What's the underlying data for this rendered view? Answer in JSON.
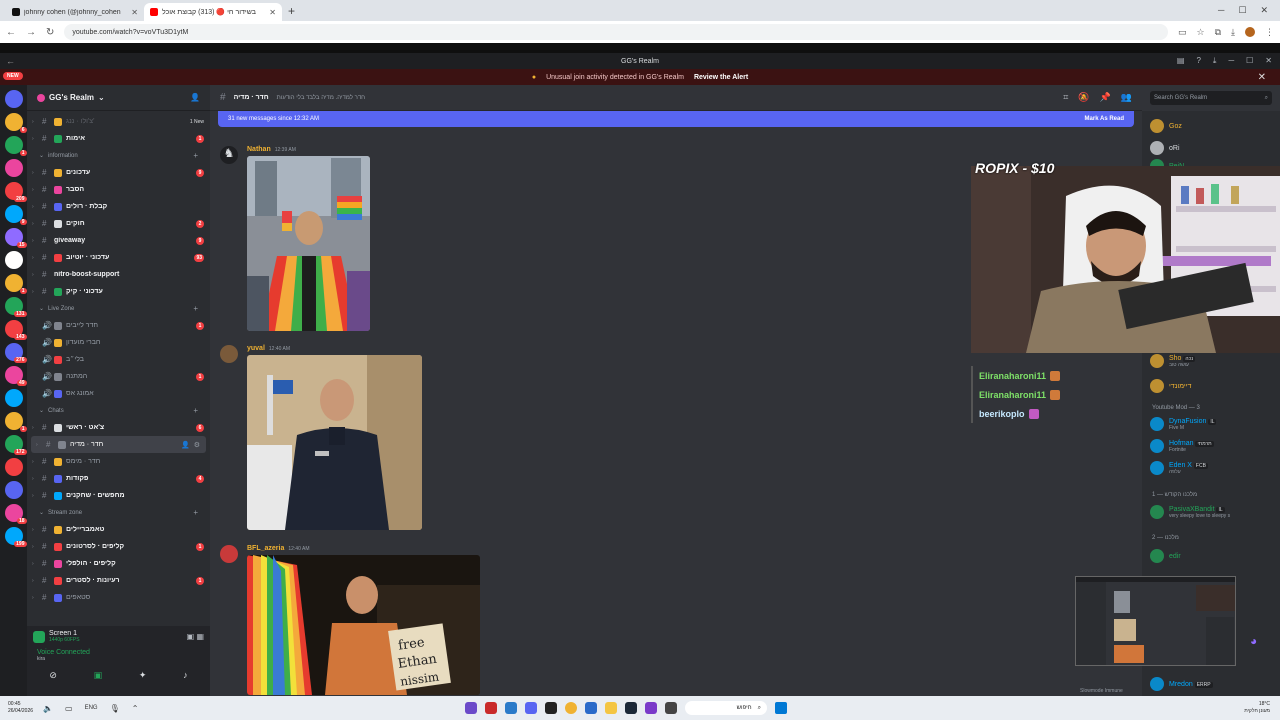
{
  "browser": {
    "tabs": [
      {
        "title": "johnny cohen (@johnny_cohen",
        "icon": "tiktok-icon",
        "color": "#111111"
      },
      {
        "title": "בשידור חי 🔴 (313) קבוצת אוכל",
        "icon": "youtube-icon",
        "color": "#ff0000"
      }
    ],
    "url": "youtube.com/watch?v=voVTu3D1ytM"
  },
  "discord": {
    "window_title": "GG's Realm",
    "alert_text": "Unusual join activity detected in GG's Realm",
    "alert_action": "Review the Alert",
    "new_label": "NEW"
  },
  "server_badges": [
    "",
    "6",
    "1",
    "",
    "209",
    "9",
    "15",
    "",
    "1",
    "131",
    "143",
    "276",
    "49",
    "",
    "1",
    "172",
    "",
    "",
    "18",
    "199"
  ],
  "sidebar": {
    "guild_name": "GG's Realm",
    "rows": [
      {
        "kind": "ch",
        "name": "צ'ולו · ננג'",
        "badge": "",
        "state": "muted",
        "emoji": "#f0b232",
        "extra": "1 New"
      },
      {
        "kind": "ch",
        "name": "אימות",
        "badge": "1",
        "state": "un",
        "emoji": "#23a559"
      },
      {
        "kind": "cat",
        "name": "information"
      },
      {
        "kind": "ch",
        "name": "עדכונים",
        "badge": "9",
        "state": "un",
        "emoji": "#f0b232"
      },
      {
        "kind": "ch",
        "name": "הסבר",
        "badge": "",
        "state": "un",
        "emoji": "#eb459e"
      },
      {
        "kind": "ch",
        "name": "קבלת · רולים",
        "badge": "",
        "state": "un",
        "emoji": "#5865f2"
      },
      {
        "kind": "ch",
        "name": "חוקים",
        "badge": "2",
        "state": "un",
        "emoji": "#dbdee1"
      },
      {
        "kind": "ch",
        "name": "giveaway",
        "badge": "9",
        "state": "un",
        "emoji": ""
      },
      {
        "kind": "ch",
        "name": "עדכוני · יוטיוב",
        "badge": "93",
        "state": "un",
        "emoji": "#f23f42"
      },
      {
        "kind": "ch",
        "name": "nitro-boost-support",
        "badge": "",
        "state": "un",
        "emoji": ""
      },
      {
        "kind": "ch",
        "name": "עדכוני · קיק",
        "badge": "",
        "state": "un",
        "emoji": "#23a559"
      },
      {
        "kind": "cat",
        "name": "Live Zone"
      },
      {
        "kind": "vc",
        "name": "חדר לייבים",
        "badge": "1",
        "state": "",
        "emoji": "#80848e"
      },
      {
        "kind": "vc",
        "name": "חברי מועדון",
        "badge": "",
        "state": "",
        "emoji": "#f0b232"
      },
      {
        "kind": "vc",
        "name": "בלי״ב",
        "badge": "",
        "state": "",
        "emoji": "#f23f42"
      },
      {
        "kind": "vc",
        "name": "המתנה",
        "badge": "1",
        "state": "",
        "emoji": "#80848e"
      },
      {
        "kind": "vc",
        "name": "אמונג אס",
        "badge": "",
        "state": "",
        "emoji": "#5865f2"
      },
      {
        "kind": "cat",
        "name": "Chats"
      },
      {
        "kind": "ch",
        "name": "צ'אט · ראשי",
        "badge": "6",
        "state": "un",
        "emoji": "#dbdee1"
      },
      {
        "kind": "ch",
        "name": "חדר · מדיה",
        "badge": "",
        "state": "sel",
        "emoji": "#80848e"
      },
      {
        "kind": "ch",
        "name": "חדר · מימס",
        "badge": "",
        "state": "",
        "emoji": "#f0b232"
      },
      {
        "kind": "ch",
        "name": "פקודות",
        "badge": "4",
        "state": "un",
        "emoji": "#5865f2"
      },
      {
        "kind": "ch",
        "name": "מחפשים · שחקנים",
        "badge": "",
        "state": "un",
        "emoji": "#00a8fc"
      },
      {
        "kind": "cat",
        "name": "Stream zone"
      },
      {
        "kind": "ch",
        "name": "טאמבריילים",
        "badge": "",
        "state": "un",
        "emoji": "#f0b232"
      },
      {
        "kind": "ch",
        "name": "קליפים · לסרטונים",
        "badge": "1",
        "state": "un",
        "emoji": "#f23f42"
      },
      {
        "kind": "ch",
        "name": "קליפים · הולפלי",
        "badge": "",
        "state": "un",
        "emoji": "#eb459e"
      },
      {
        "kind": "ch",
        "name": "רעיונות · לסטרים",
        "badge": "1",
        "state": "un",
        "emoji": "#f23f42"
      },
      {
        "kind": "ch",
        "name": "סטאפים",
        "badge": "",
        "state": "",
        "emoji": "#5865f2"
      }
    ],
    "screen_share": {
      "title": "Screen 1",
      "sub": "1440p 60FPS"
    },
    "voice": {
      "status": "Voice Connected",
      "channel": "kira"
    }
  },
  "channel": {
    "name": "חדר · מדיה",
    "topic": "חדר למדיה. מדיה בלבד בלי הודעות",
    "search_placeholder": "Search GG's Realm",
    "new_messages": "31 new messages since 12:32 AM",
    "mark_read": "Mark As Read"
  },
  "messages": [
    {
      "user": "Nathan",
      "time": "12:39 AM",
      "color": "#f0b232"
    },
    {
      "user": "yuval",
      "time": "12:40 AM",
      "color": "#f0b232"
    },
    {
      "user": "BFL_azeria",
      "time": "12:40 AM",
      "color": "#f0b232"
    }
  ],
  "image_texts": {
    "sign_line1": "free",
    "sign_line2": "Ethan",
    "sign_line3": "nissim"
  },
  "stream": {
    "overlay_label": "ROPIX - $10",
    "chat": [
      {
        "name": "Eliranaharoni11",
        "color": "#7ee068"
      },
      {
        "name": "Eliranaharoni11",
        "color": "#7ee068"
      },
      {
        "name": "beerikoplo",
        "color": "#c6e9ff"
      }
    ]
  },
  "members": [
    {
      "name": "Goz",
      "color": "#f0b232",
      "status": ""
    },
    {
      "name": "oRi",
      "color": "#dbdee1",
      "status": ""
    },
    {
      "name": "PeiN",
      "color": "#23a559",
      "status": ""
    },
    {
      "name": "Sho",
      "color": "#f0b232",
      "status": "עושה טוב",
      "tag": "נכה"
    },
    {
      "name": "דיימונדי",
      "color": "#f0b232",
      "status": ""
    }
  ],
  "member_groups": {
    "mods": "Youtube Mod — 3",
    "group2": "מלכנו הקודש — 1",
    "group3": "מלכנו — 2"
  },
  "mods": [
    {
      "name": "DynaFusion",
      "color": "#00a8fc",
      "status": "Five M",
      "tag": "IL"
    },
    {
      "name": "Hofman",
      "color": "#00a8fc",
      "status": "Fortnite",
      "tag": "תרמתי"
    },
    {
      "name": "Eden X",
      "color": "#00a8fc",
      "status": "עלפה",
      "tag": "FCB"
    }
  ],
  "group2_members": [
    {
      "name": "PasivaXBandit",
      "color": "#23a559",
      "status": "very sleepy love to sleepy s",
      "tag": "IL"
    }
  ],
  "group3_members": [
    {
      "name": "edir",
      "color": "#23a559",
      "status": "",
      "tag": ""
    },
    {
      "name": "Mredon",
      "color": "#00a8fc",
      "status": "",
      "tag": "ERRP"
    }
  ],
  "slowmode": "Slowmode Immune",
  "taskbar": {
    "time": "00:45",
    "date": "26/04/2026",
    "lang": "ENG",
    "search": "חיפוש",
    "weather": "18°C",
    "weather_sub": "מעונן חלקית"
  }
}
